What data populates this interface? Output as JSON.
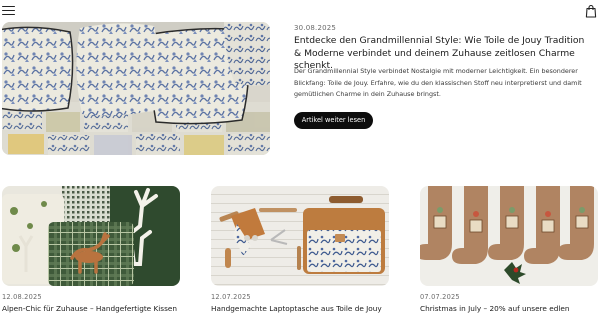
{
  "header": {
    "menu_icon": "hamburger-menu-icon",
    "cart_icon": "shopping-bag-icon"
  },
  "featured": {
    "date": "30.08.2025",
    "title": "Entdecke den Grandmillennial Style: Wie Toile de Jouy Tradition & Moderne verbindet und deinem Zuhause zeitlosen Charme schenkt.",
    "excerpt": "Der Grandmillennial Style verbindet Nostalgie mit moderner Leichtigkeit. Ein besonderer Blickfang: Toile de Jouy. Erfahre, wie du den klassischen Stoff neu interpretierst und damit gemütlichen Charme in dein Zuhause bringst.",
    "button_label": "Artikel weiter lesen",
    "button_bg": "#0d0d0d"
  },
  "posts": [
    {
      "date": "12.08.2025",
      "title": "Alpen-Chic für Zuhause – Handgefertigte Kissen"
    },
    {
      "date": "12.07.2025",
      "title": "Handgemachte Laptoptasche aus Toile de Jouy"
    },
    {
      "date": "07.07.2025",
      "title": "Christmas in July – 20% auf unsere edlen"
    }
  ],
  "colors": {
    "toile_blue": "#5a72a3",
    "cream": "#e9e4d6",
    "tartan_green": "#3f5a3a",
    "stocking_brown": "#b08462"
  }
}
